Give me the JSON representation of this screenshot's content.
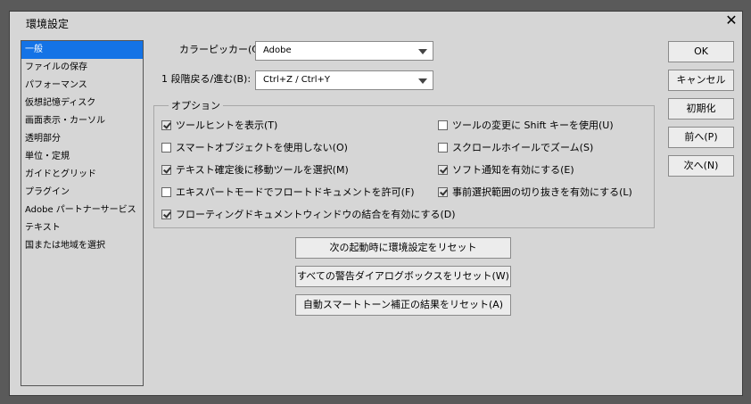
{
  "window": {
    "title": "環境設定"
  },
  "sidebar": {
    "items": [
      {
        "label": "一般",
        "selected": true
      },
      {
        "label": "ファイルの保存"
      },
      {
        "label": "パフォーマンス"
      },
      {
        "label": "仮想記憶ディスク"
      },
      {
        "label": "画面表示・カーソル"
      },
      {
        "label": "透明部分"
      },
      {
        "label": "単位・定規"
      },
      {
        "label": "ガイドとグリッド"
      },
      {
        "label": "プラグイン"
      },
      {
        "label": "Adobe パートナーサービス"
      },
      {
        "label": "テキスト"
      },
      {
        "label": "国または地域を選択"
      }
    ]
  },
  "general": {
    "color_picker": {
      "label": "カラーピッカー(C):",
      "value": "Adobe"
    },
    "undo_redo": {
      "label": "1 段階戻る/進む(B):",
      "value": "Ctrl+Z / Ctrl+Y"
    }
  },
  "options": {
    "title": "オプション",
    "left": [
      {
        "label": "ツールヒントを表示(T)",
        "checked": true
      },
      {
        "label": "スマートオブジェクトを使用しない(O)",
        "checked": false
      },
      {
        "label": "テキスト確定後に移動ツールを選択(M)",
        "checked": true
      },
      {
        "label": "エキスパートモードでフロートドキュメントを許可(F)",
        "checked": false
      },
      {
        "label": "フローティングドキュメントウィンドウの結合を有効にする(D)",
        "checked": true
      }
    ],
    "right": [
      {
        "label": "ツールの変更に Shift キーを使用(U)",
        "checked": false
      },
      {
        "label": "スクロールホイールでズーム(S)",
        "checked": false
      },
      {
        "label": "ソフト通知を有効にする(E)",
        "checked": true
      },
      {
        "label": "事前選択範囲の切り抜きを有効にする(L)",
        "checked": true
      }
    ]
  },
  "reset_buttons": [
    "次の起動時に環境設定をリセット",
    "すべての警告ダイアログボックスをリセット(W)",
    "自動スマートトーン補正の結果をリセット(A)"
  ],
  "side_buttons": {
    "ok": "OK",
    "cancel": "キャンセル",
    "reset": "初期化",
    "prev": "前へ(P)",
    "next": "次へ(N)"
  },
  "colors": {
    "selection": "#1473e6",
    "panel": "#d6d6d6",
    "outer": "#5a5a5a"
  }
}
